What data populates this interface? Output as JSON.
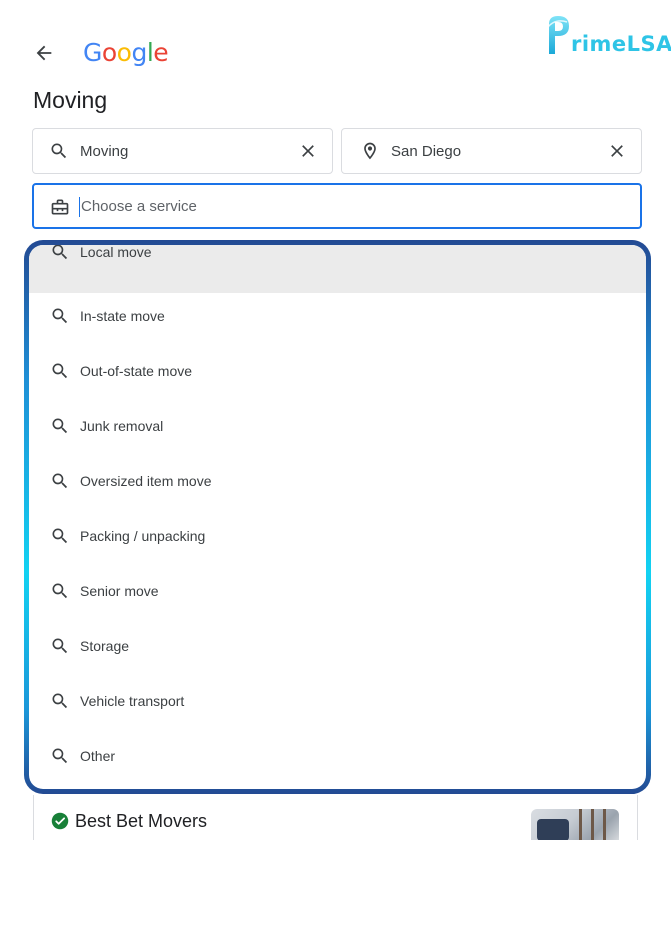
{
  "header": {
    "logo_letters": [
      "G",
      "o",
      "o",
      "g",
      "l",
      "e"
    ],
    "logo_colors": [
      "#4285F4",
      "#EA4335",
      "#FBBC05",
      "#4285F4",
      "#34A853",
      "#EA4335"
    ],
    "brand_text": "rimeLSA",
    "brand_logo_text": "PrimeLSA"
  },
  "page": {
    "title": "Moving"
  },
  "search": {
    "category_value": "Moving",
    "location_value": "San Diego",
    "service_placeholder": "Choose a service"
  },
  "dropdown": {
    "options": [
      {
        "label": "Local move"
      },
      {
        "label": "In-state move"
      },
      {
        "label": "Out-of-state move"
      },
      {
        "label": "Junk removal"
      },
      {
        "label": "Oversized item move"
      },
      {
        "label": "Packing / unpacking"
      },
      {
        "label": "Senior move"
      },
      {
        "label": "Storage"
      },
      {
        "label": "Vehicle transport"
      },
      {
        "label": "Other"
      }
    ],
    "highlighted_index": 0
  },
  "result": {
    "name": "Best Bet Movers"
  },
  "colors": {
    "accent": "#1a73e8",
    "verified": "#188038",
    "brand": "#2ec4e6"
  },
  "icons": {
    "back": "arrow-left-icon",
    "search": "search-icon",
    "clear": "close-icon",
    "location": "location-pin-icon",
    "service": "briefcase-icon",
    "verified": "verified-check-icon"
  }
}
